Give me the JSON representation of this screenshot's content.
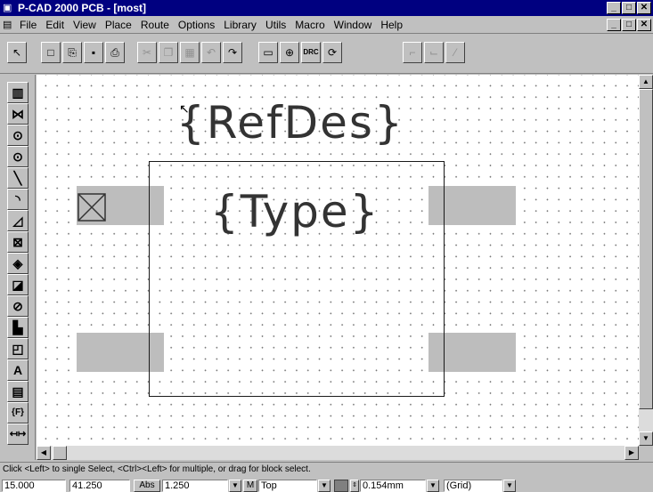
{
  "window": {
    "title": "P-CAD 2000 PCB - [most]",
    "min": "_",
    "max": "□",
    "close": "✕"
  },
  "menu": [
    "File",
    "Edit",
    "View",
    "Place",
    "Route",
    "Options",
    "Library",
    "Utils",
    "Macro",
    "Window",
    "Help"
  ],
  "toolbar": {
    "drc_label": "DRC"
  },
  "canvas": {
    "refdes": "{RefDes}",
    "type": "{Type}"
  },
  "left_tools": {
    "text_tool": "A",
    "field_tool": "{F}"
  },
  "status": {
    "message": "Click <Left> to single Select, <Ctrl><Left> for multiple, or drag for block select.",
    "x": "15.000",
    "y": "41.250",
    "abs": "Abs",
    "grid": "1.250",
    "m": "M",
    "layer": "Top",
    "line_width": "0.154mm",
    "grid_mode": "(Grid)"
  },
  "colors": {
    "title_bg": "#000080",
    "chrome": "#c0c0c0",
    "pad": "#bdbdbd"
  }
}
